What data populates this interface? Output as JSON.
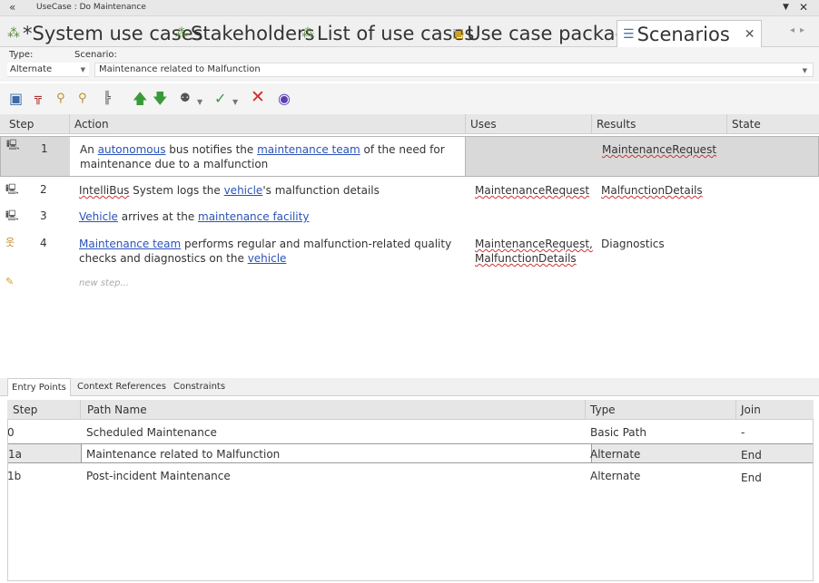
{
  "window": {
    "title": "UseCase : Do Maintenance"
  },
  "tabs": [
    {
      "label": "*System use cases"
    },
    {
      "label": "Stakeholders"
    },
    {
      "label": "List of use cases"
    },
    {
      "label": "Use case packages"
    },
    {
      "label": "Scenarios"
    }
  ],
  "filter": {
    "type_label": "Type:",
    "scenario_label": "Scenario:",
    "type_value": "Alternate",
    "scenario_value": "Maintenance related to Malfunction"
  },
  "steps_grid": {
    "headers": {
      "step": "Step",
      "action": "Action",
      "uses": "Uses",
      "results": "Results",
      "state": "State"
    },
    "rows": [
      {
        "num": "1",
        "action": {
          "a": "An ",
          "l1": "autonomous",
          "b": " bus notifies the ",
          "l2": "maintenance team",
          "c": " of the need for maintenance due to a malfunction"
        },
        "uses": "",
        "results": "MaintenanceRequest"
      },
      {
        "num": "2",
        "action": {
          "a": "IntelliBus",
          "b": " System logs the ",
          "l1": "vehicle",
          "c": "'s malfunction details"
        },
        "uses": "MaintenanceRequest",
        "results": "MalfunctionDetails"
      },
      {
        "num": "3",
        "action": {
          "l1": "Vehicle",
          "b": " arrives at the ",
          "l2": "maintenance facility"
        },
        "uses": "",
        "results": ""
      },
      {
        "num": "4",
        "action": {
          "l1": "Maintenance team",
          "b": " performs regular and malfunction-related quality checks and diagnostics on the ",
          "l2": "vehicle"
        },
        "uses": "MaintenanceRequest, MalfunctionDetails",
        "results": "Diagnostics"
      }
    ],
    "new_step_placeholder": "new step..."
  },
  "bottom_panel": {
    "tabs": [
      "Entry Points",
      "Context References",
      "Constraints"
    ],
    "headers": {
      "step": "Step",
      "path_name": "Path Name",
      "type": "Type",
      "join": "Join"
    },
    "rows": [
      {
        "step": "0",
        "path_name": "Scheduled Maintenance",
        "type": "Basic Path",
        "join": "-"
      },
      {
        "step": "1a",
        "path_name": "Maintenance related to Malfunction",
        "type": "Alternate",
        "join": "End"
      },
      {
        "step": "1b",
        "path_name": "Post-incident Maintenance",
        "type": "Alternate",
        "join": "End"
      }
    ]
  },
  "colors": {
    "link": "#2a52b8",
    "selected_row": "#d9d9d9",
    "header_bg": "#e6e6e6"
  }
}
